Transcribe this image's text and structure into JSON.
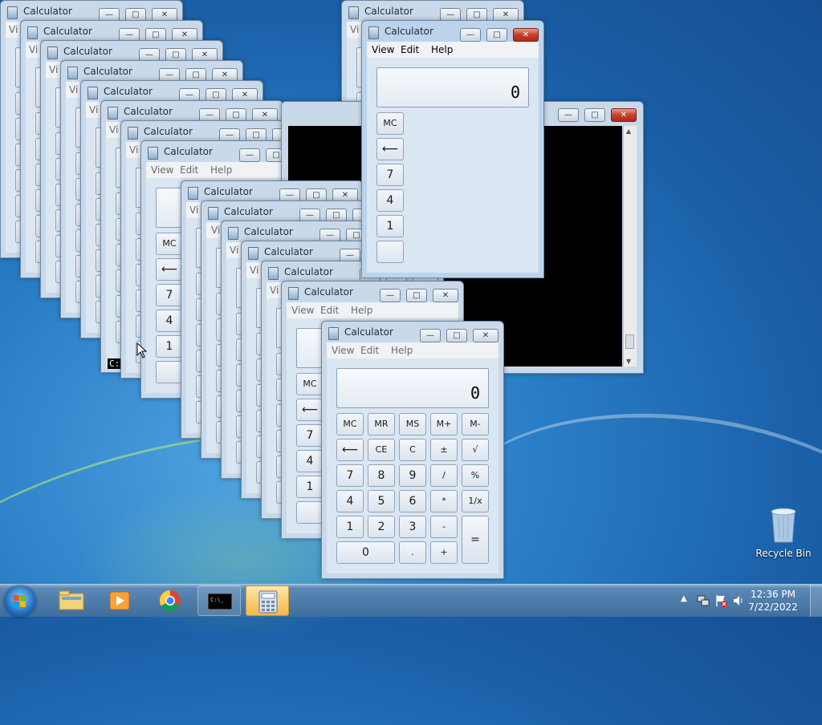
{
  "calc": {
    "title": "Calculator",
    "menu": {
      "view": "View",
      "edit": "Edit",
      "help": "Help"
    },
    "display_value": "0",
    "partial_menu": "Vi",
    "buttons": {
      "mc": "MC",
      "mr": "MR",
      "ms": "MS",
      "mplus": "M+",
      "mminus": "M-",
      "back": "⟵",
      "ce": "CE",
      "c": "C",
      "sign": "±",
      "sqrt": "√",
      "n7": "7",
      "n8": "8",
      "n9": "9",
      "div": "/",
      "pct": "%",
      "n4": "4",
      "n5": "5",
      "n6": "6",
      "mul": "*",
      "recip": "1/x",
      "n1": "1",
      "n2": "2",
      "n3": "3",
      "sub": "-",
      "eq": "=",
      "n0": "0",
      "dot": ".",
      "add": "+"
    }
  },
  "console": {
    "prompt_fragment": "C:"
  },
  "desktop": {
    "recycle_bin": "Recycle Bin"
  },
  "taskbar": {
    "time": "12:36 PM",
    "date": "7/22/2022",
    "pinned": [
      "start-orb",
      "windows-explorer",
      "media-player",
      "chrome",
      "command-prompt",
      "calculator"
    ]
  }
}
